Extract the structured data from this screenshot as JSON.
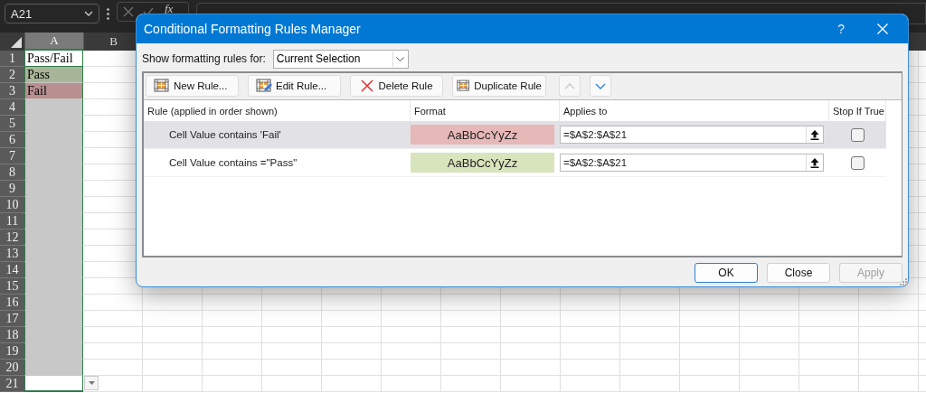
{
  "name_box": {
    "value": "A21"
  },
  "formula_bar": {
    "function_label": "fx"
  },
  "column_headers": [
    {
      "label": "A",
      "selected": true
    },
    {
      "label": "B",
      "selected": false
    }
  ],
  "rows": [
    {
      "number": "1",
      "value": "Pass/Fail",
      "selected": false
    },
    {
      "number": "2",
      "value": "Pass",
      "selected": true,
      "color": "#a9b598"
    },
    {
      "number": "3",
      "value": "Fail",
      "selected": true,
      "color": "#b98f8f"
    },
    {
      "number": "4",
      "selected": true
    },
    {
      "number": "5",
      "selected": true
    },
    {
      "number": "6",
      "selected": true
    },
    {
      "number": "7",
      "selected": true
    },
    {
      "number": "8",
      "selected": true
    },
    {
      "number": "9",
      "selected": true
    },
    {
      "number": "10",
      "selected": true
    },
    {
      "number": "11",
      "selected": true
    },
    {
      "number": "12",
      "selected": true
    },
    {
      "number": "13",
      "selected": true
    },
    {
      "number": "14",
      "selected": true
    },
    {
      "number": "15",
      "selected": true
    },
    {
      "number": "16",
      "selected": true
    },
    {
      "number": "17",
      "selected": true
    },
    {
      "number": "18",
      "selected": true
    },
    {
      "number": "19",
      "selected": true
    },
    {
      "number": "20",
      "selected": true
    },
    {
      "number": "21",
      "selected": false
    }
  ],
  "dialog": {
    "title": "Conditional Formatting Rules Manager",
    "help": "?",
    "scope_label": "Show formatting rules for:",
    "scope_value": "Current Selection",
    "toolbar": [
      {
        "label": "New Rule...",
        "kind": "new"
      },
      {
        "label": "Edit Rule...",
        "kind": "edit"
      },
      {
        "label": "Delete Rule",
        "kind": "delete"
      },
      {
        "label": "Duplicate Rule",
        "kind": "duplicate"
      }
    ],
    "move_up": {
      "disabled": true
    },
    "move_down": {
      "disabled": false
    },
    "columns": [
      "Rule (applied in order shown)",
      "Format",
      "Applies to",
      "Stop If True"
    ],
    "rules": [
      {
        "condition": "Cell Value contains 'Fail'",
        "preview": "AaBbCcYyZz",
        "color": "#e6b8b7",
        "applies_to": "=$A$2:$A$21",
        "stop_if_true": false,
        "selected": true
      },
      {
        "condition": "Cell Value contains =\"Pass\"",
        "preview": "AaBbCcYyZz",
        "color": "#d8e4bc",
        "applies_to": "=$A$2:$A$21",
        "stop_if_true": false,
        "selected": false
      }
    ],
    "buttons": [
      {
        "label": "OK",
        "kind": "default",
        "disabled": false
      },
      {
        "label": "Close",
        "kind": "normal",
        "disabled": false
      },
      {
        "label": "Apply",
        "kind": "normal",
        "disabled": true
      }
    ]
  }
}
